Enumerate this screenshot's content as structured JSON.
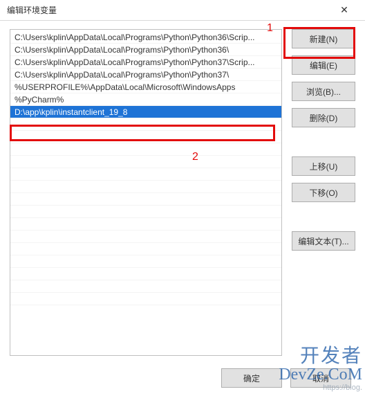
{
  "window": {
    "title": "编辑环境变量"
  },
  "paths": [
    "C:\\Users\\kplin\\AppData\\Local\\Programs\\Python\\Python36\\Scrip...",
    "C:\\Users\\kplin\\AppData\\Local\\Programs\\Python\\Python36\\",
    "C:\\Users\\kplin\\AppData\\Local\\Programs\\Python\\Python37\\Scrip...",
    "C:\\Users\\kplin\\AppData\\Local\\Programs\\Python\\Python37\\",
    "%USERPROFILE%\\AppData\\Local\\Microsoft\\WindowsApps",
    "%PyCharm%",
    "D:\\app\\kplin\\instantclient_19_8"
  ],
  "selected_index": 6,
  "buttons": {
    "new": "新建(N)",
    "edit": "编辑(E)",
    "browse": "浏览(B)...",
    "delete": "删除(D)",
    "moveup": "上移(U)",
    "movedown": "下移(O)",
    "edittext": "编辑文本(T)...",
    "ok": "确定",
    "cancel": "取消"
  },
  "annotations": {
    "label1": "1",
    "label2": "2"
  },
  "watermark": {
    "line1": "开发者",
    "line2": "DevZe.CoM",
    "line3": "https://blog."
  }
}
